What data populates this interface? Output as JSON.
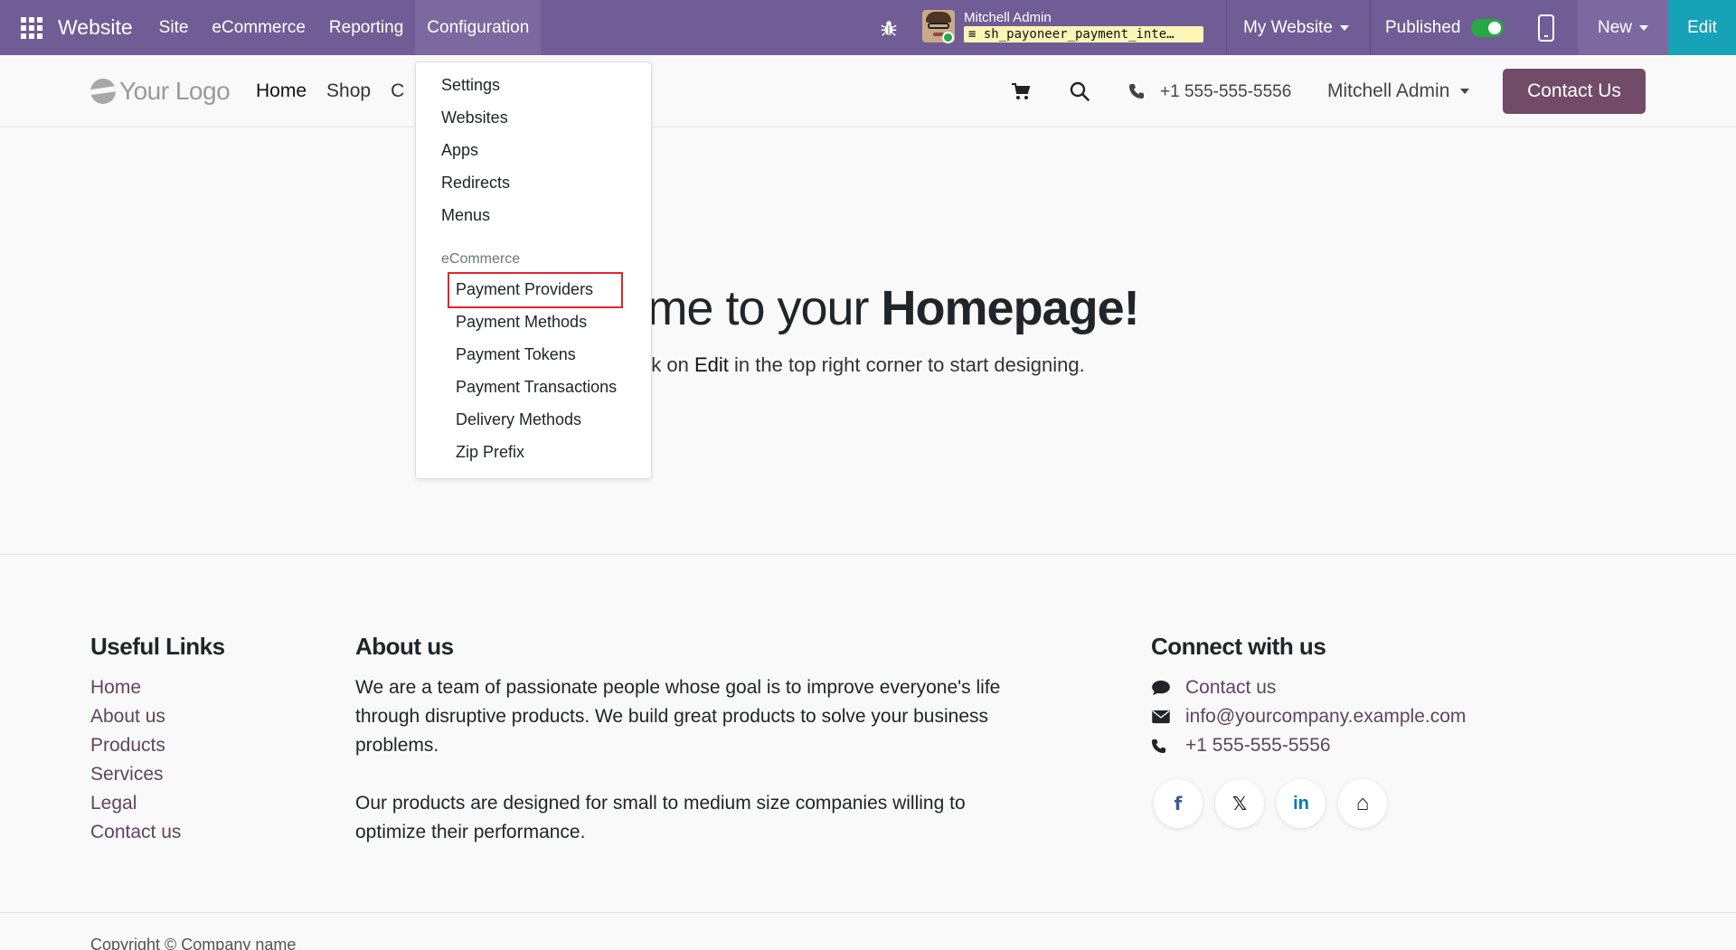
{
  "topbar": {
    "brand": "Website",
    "menu": [
      {
        "label": "Site"
      },
      {
        "label": "eCommerce"
      },
      {
        "label": "Reporting"
      },
      {
        "label": "Configuration"
      }
    ],
    "user_name": "Mitchell Admin",
    "database": "sh_payoneer_payment_inte…",
    "website_switcher": "My Website",
    "published_label": "Published",
    "new_label": "New",
    "edit_label": "Edit",
    "accent_color": "#705d95",
    "edit_color": "#17a2b8"
  },
  "site_header": {
    "logo_text": "Your Logo",
    "nav": [
      "Home",
      "Shop",
      "C"
    ],
    "phone": "+1 555-555-5556",
    "user_menu": "Mitchell Admin",
    "contact_button": "Contact Us",
    "contact_color": "#714b67"
  },
  "hero": {
    "title_prefix": "come to your ",
    "title_bold": "Homepage!",
    "subtitle_prefix": "k on ",
    "subtitle_bold": "Edit",
    "subtitle_suffix": " in the top right corner to start designing."
  },
  "config_menu": {
    "items": [
      "Settings",
      "Websites",
      "Apps",
      "Redirects",
      "Menus"
    ],
    "section_header": "eCommerce",
    "section_items": [
      "Payment Providers",
      "Payment Methods",
      "Payment Tokens",
      "Payment Transactions",
      "Delivery Methods",
      "Zip Prefix"
    ],
    "highlighted_item": "Payment Providers",
    "highlight_color": "#e3242b"
  },
  "footer": {
    "useful_links_title": "Useful Links",
    "useful_links": [
      "Home",
      "About us",
      "Products",
      "Services",
      "Legal",
      "Contact us"
    ],
    "about_title": "About us",
    "about_p1": "We are a team of passionate people whose goal is to improve everyone's life through disruptive products. We build great products to solve your business problems.",
    "about_p2": "Our products are designed for small to medium size companies willing to optimize their performance.",
    "connect_title": "Connect with us",
    "connect_items": [
      {
        "icon": "comment-icon",
        "label": "Contact us"
      },
      {
        "icon": "envelope-icon",
        "label": "info@yourcompany.example.com"
      },
      {
        "icon": "phone-icon",
        "label": "+1 555-555-5556"
      }
    ],
    "social": [
      {
        "icon": "facebook-icon",
        "glyph": "f"
      },
      {
        "icon": "x-twitter-icon",
        "glyph": "𝕏"
      },
      {
        "icon": "linkedin-icon",
        "glyph": "in"
      },
      {
        "icon": "home-icon",
        "glyph": "⌂"
      }
    ],
    "copyright": "Copyright © Company name"
  }
}
